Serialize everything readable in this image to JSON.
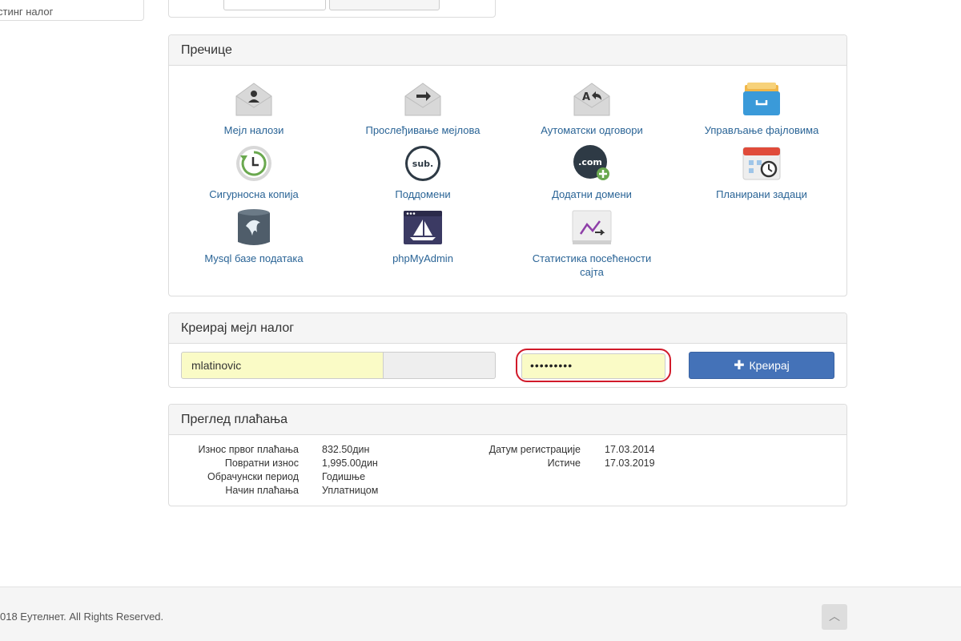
{
  "sidebar": {
    "fragment_label": "стинг налог"
  },
  "shortcuts": {
    "title": "Пречице",
    "items": [
      {
        "label": "Мејл налози",
        "icon": "mail-account-icon"
      },
      {
        "label": "Прослеђивање мејлова",
        "icon": "mail-forward-icon"
      },
      {
        "label": "Аутоматски одговори",
        "icon": "autoresponder-icon"
      },
      {
        "label": "Управљање фајловима",
        "icon": "file-manager-icon"
      },
      {
        "label": "Сигурносна копија",
        "icon": "backup-icon"
      },
      {
        "label": "Поддомени",
        "icon": "subdomain-icon"
      },
      {
        "label": "Додатни домени",
        "icon": "addon-domain-icon"
      },
      {
        "label": "Планирани задаци",
        "icon": "cron-calendar-icon"
      },
      {
        "label": "Mysql базе података",
        "icon": "mysql-database-icon"
      },
      {
        "label": "phpMyAdmin",
        "icon": "phpmyadmin-icon"
      },
      {
        "label": "Статистика посећености сајта",
        "icon": "stats-chart-icon"
      }
    ],
    "icon_texts": {
      "subdomain": "sub.",
      "addon": ".com"
    }
  },
  "create_mail": {
    "title": "Креирај мејл налог",
    "username_value": "mlatinovic",
    "password_value": "•••••••••",
    "button_label": "Креирај"
  },
  "billing": {
    "title": "Преглед плаћања",
    "left": [
      {
        "label": "Износ првог плаћања",
        "value": "832.50дин"
      },
      {
        "label": "Повратни износ",
        "value": "1,995.00дин"
      },
      {
        "label": "Обрачунски период",
        "value": "Годишње"
      },
      {
        "label": "Начин плаћања",
        "value": "Уплатницом"
      }
    ],
    "right": [
      {
        "label": "Датум регистрације",
        "value": "17.03.2014"
      },
      {
        "label": "Истиче",
        "value": "17.03.2019"
      }
    ]
  },
  "footer": {
    "copyright": "018 Еутелнет. All Rights Reserved."
  },
  "colors": {
    "accent": "#4472b8",
    "link": "#2a6496",
    "highlight_ring": "#d11a2a",
    "autofill": "#fafbc6"
  }
}
